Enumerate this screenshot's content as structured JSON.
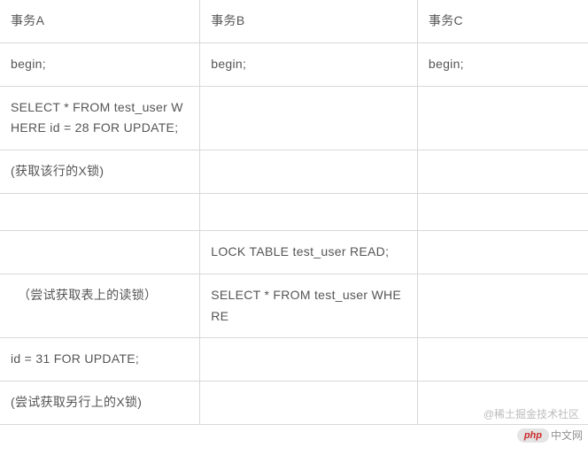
{
  "table": {
    "headers": [
      "事务A",
      "事务B",
      "事务C"
    ],
    "rows": [
      {
        "a": "begin;",
        "b": "begin;",
        "c": "begin;"
      },
      {
        "a": "SELECT * FROM test_user WHERE id = 28 FOR UPDATE;",
        "b": "",
        "c": ""
      },
      {
        "a": "(获取该行的X锁)",
        "b": "",
        "c": ""
      },
      {
        "a": "",
        "b": "",
        "c": ""
      },
      {
        "a": "",
        "b": "LOCK TABLE test_user READ;",
        "c": ""
      },
      {
        "a": "（尝试获取表上的读锁）",
        "aIndent": true,
        "b": "SELECT * FROM test_user WHERE",
        "c": ""
      },
      {
        "a": "id = 31 FOR UPDATE;",
        "b": "",
        "c": ""
      },
      {
        "a": "(尝试获取另行上的X锁)",
        "b": "",
        "c": ""
      }
    ]
  },
  "watermark": {
    "phpText": "php",
    "phpLabel": "中文网",
    "juejin": "@稀土掘金技术社区"
  }
}
